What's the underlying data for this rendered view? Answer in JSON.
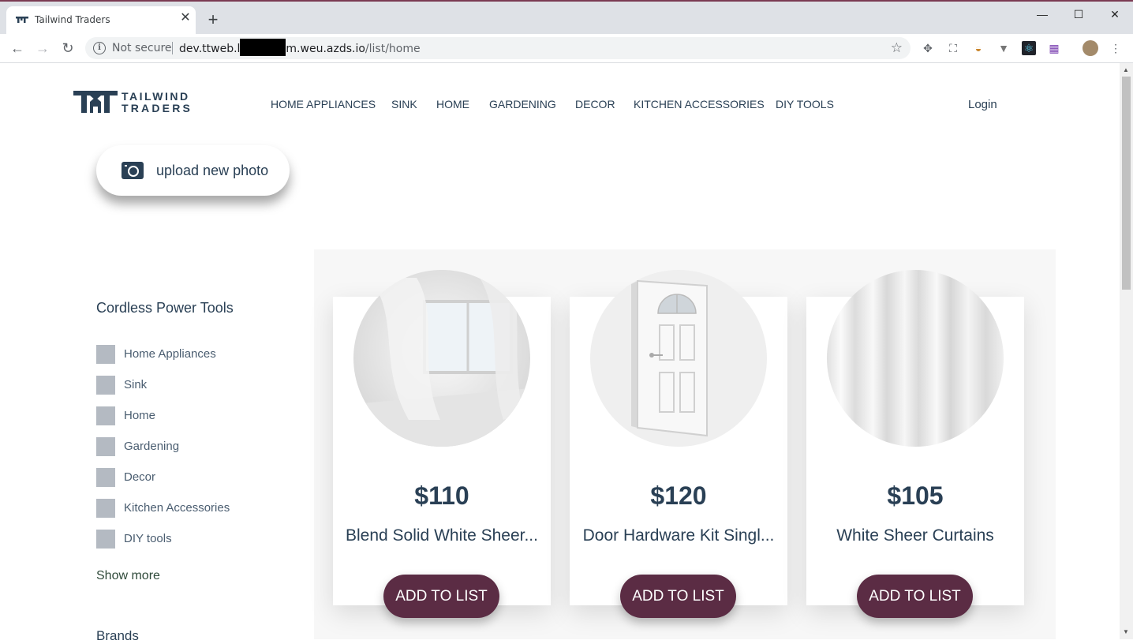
{
  "browser": {
    "tab_title": "Tailwind Traders",
    "security_label": "Not secure",
    "url_host_start": "dev.ttweb.l",
    "url_host_end": "m.weu.azds.io",
    "url_path": "/list/home"
  },
  "header": {
    "logo_line1": "TAILWIND",
    "logo_line2": "TRADERS",
    "nav": [
      "HOME APPLIANCES",
      "SINK",
      "HOME",
      "GARDENING",
      "DECOR",
      "KITCHEN ACCESSORIES",
      "DIY TOOLS"
    ],
    "login": "Login"
  },
  "upload": {
    "label": "upload new photo"
  },
  "sidebar": {
    "title": "Cordless Power Tools",
    "categories": [
      "Home Appliances",
      "Sink",
      "Home",
      "Gardening",
      "Decor",
      "Kitchen Accessories",
      "DIY tools"
    ],
    "show_more": "Show more",
    "brands_title": "Brands"
  },
  "products": [
    {
      "price": "$110",
      "name": "Blend Solid White Sheer...",
      "button": "ADD TO LIST"
    },
    {
      "price": "$120",
      "name": "Door Hardware Kit Singl...",
      "button": "ADD TO LIST"
    },
    {
      "price": "$105",
      "name": "White Sheer Curtains",
      "button": "ADD TO LIST"
    }
  ],
  "colors": {
    "brand": "#2a4055",
    "button": "#5b2c44"
  }
}
